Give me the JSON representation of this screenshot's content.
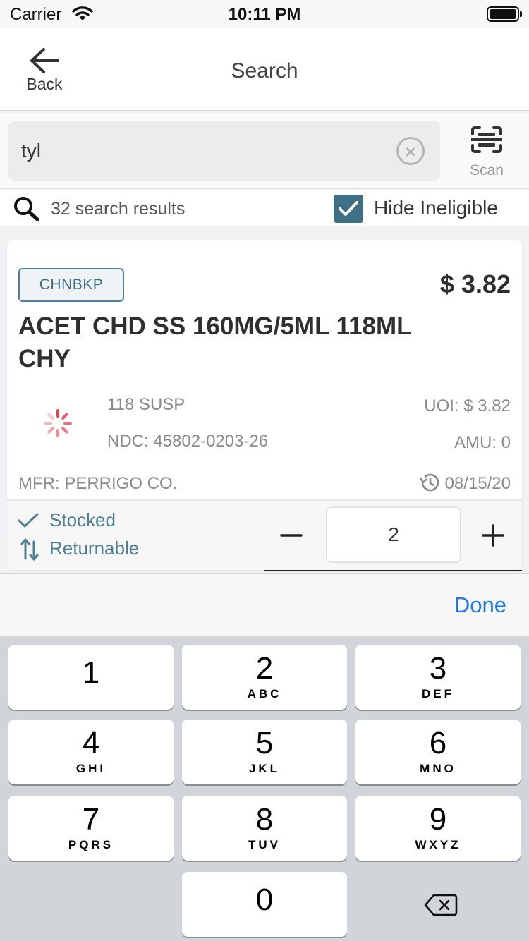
{
  "status_bar": {
    "carrier": "Carrier",
    "time": "10:11 PM"
  },
  "nav": {
    "back_label": "Back",
    "title": "Search"
  },
  "search": {
    "query": "tyl",
    "scan_label": "Scan"
  },
  "results": {
    "count_text": "32 search results",
    "hide_ineligible_label": "Hide Ineligible",
    "hide_ineligible_checked": true
  },
  "product": {
    "badge": "CHNBKP",
    "price": "$ 3.82",
    "name": "ACET CHD SS 160MG/5ML 118ML CHY",
    "package": "118 SUSP",
    "ndc": "NDC: 45802-0203-26",
    "uoi": "UOI: $ 3.82",
    "amu": "AMU: 0",
    "mfr": "MFR: PERRIGO CO.",
    "date": "08/15/20",
    "stocked_label": "Stocked",
    "returnable_label": "Returnable",
    "quantity": "2"
  },
  "keyboard": {
    "done_label": "Done",
    "keys": [
      {
        "num": "1",
        "letters": ""
      },
      {
        "num": "2",
        "letters": "ABC"
      },
      {
        "num": "3",
        "letters": "DEF"
      },
      {
        "num": "4",
        "letters": "GHI"
      },
      {
        "num": "5",
        "letters": "JKL"
      },
      {
        "num": "6",
        "letters": "MNO"
      },
      {
        "num": "7",
        "letters": "PQRS"
      },
      {
        "num": "8",
        "letters": "TUV"
      },
      {
        "num": "9",
        "letters": "WXYZ"
      },
      {
        "num": "0",
        "letters": ""
      }
    ]
  },
  "colors": {
    "accent": "#3e6f84",
    "link": "#1f7ae0",
    "spinner": "#e0485a"
  }
}
